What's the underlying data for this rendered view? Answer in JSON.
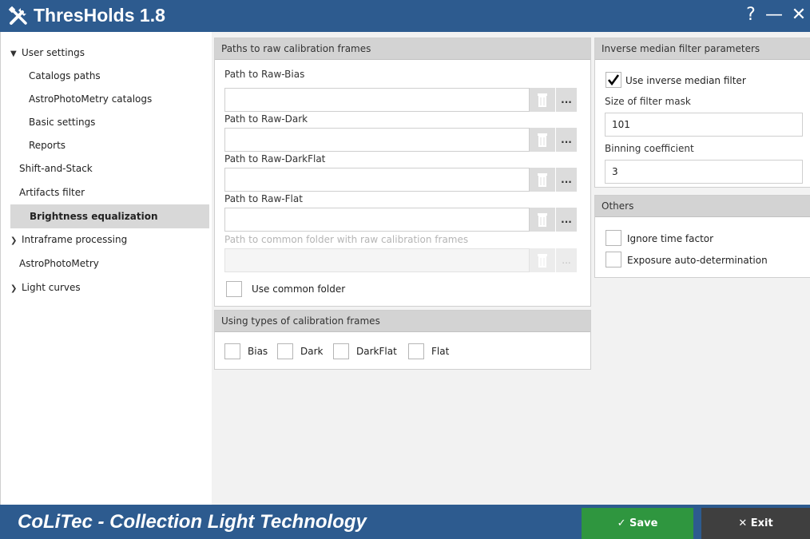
{
  "app": {
    "title": "ThresHolds 1.8",
    "window_buttons": {
      "help": "?",
      "minimize": "—",
      "close": "✕"
    }
  },
  "sidebar": {
    "items": [
      {
        "label": "User settings",
        "expanded": true
      },
      {
        "label": "Catalogs paths"
      },
      {
        "label": "AstroPhotoMetry catalogs"
      },
      {
        "label": "Basic settings"
      },
      {
        "label": "Reports"
      },
      {
        "label": "Shift-and-Stack"
      },
      {
        "label": "Artifacts filter"
      },
      {
        "label": "Brightness equalization",
        "active": true
      },
      {
        "label": "Intraframe processing",
        "expanded": false
      },
      {
        "label": "AstroPhotoMetry"
      },
      {
        "label": "Light curves",
        "expanded": false
      }
    ]
  },
  "paths_panel": {
    "header": "Paths to raw calibration frames",
    "fields": [
      {
        "label": "Path to Raw-Bias",
        "value": ""
      },
      {
        "label": "Path to Raw-Dark",
        "value": ""
      },
      {
        "label": "Path to Raw-DarkFlat",
        "value": ""
      },
      {
        "label": "Path to Raw-Flat",
        "value": ""
      },
      {
        "label": "Path to common folder with raw calibration frames",
        "value": "",
        "disabled": true
      }
    ],
    "browse_label": "...",
    "use_common_folder": {
      "label": "Use common folder",
      "checked": false
    }
  },
  "types_panel": {
    "header": "Using types of calibration frames",
    "options": [
      {
        "label": "Bias",
        "checked": false
      },
      {
        "label": "Dark",
        "checked": false
      },
      {
        "label": "DarkFlat",
        "checked": false
      },
      {
        "label": "Flat",
        "checked": false
      }
    ]
  },
  "median_panel": {
    "header": "Inverse median filter parameters",
    "use_filter": {
      "label": "Use inverse median filter",
      "checked": true
    },
    "mask_label": "Size of filter mask",
    "mask_value": "101",
    "binning_label": "Binning coefficient",
    "binning_value": "3"
  },
  "others_panel": {
    "header": "Others",
    "options": [
      {
        "label": "Ignore time factor",
        "checked": false
      },
      {
        "label": "Exposure auto-determination",
        "checked": false
      }
    ]
  },
  "footer": {
    "brand": "CoLiTec - Collection Light Technology",
    "save_label": "Save",
    "exit_label": "Exit"
  },
  "colors": {
    "titlebar": "#2d5b8f",
    "save": "#2f963f",
    "exit": "#3f3f3f",
    "active_nav": "#d8d8d8"
  }
}
